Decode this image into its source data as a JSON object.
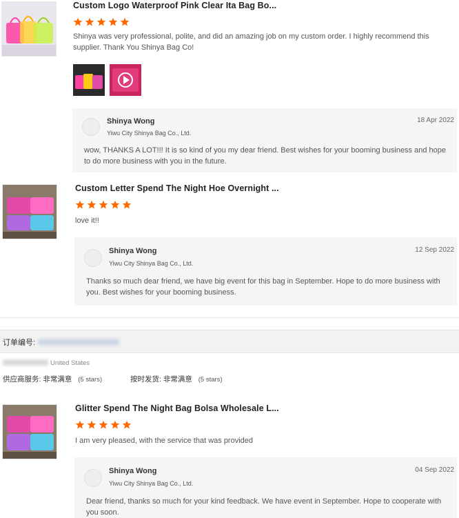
{
  "reviews": [
    {
      "product_title": "Custom Logo Waterproof Pink Clear Ita Bag Bo...",
      "rating": 5,
      "comment": "Shinya was very professional, polite, and did an amazing job on my custom order. I highly recommend this supplier. Thank You Shinya Bag Co!",
      "media_icons": [
        "photo-thumb",
        "video-play-icon"
      ],
      "reply": {
        "name": "Shinya Wong",
        "company": "Yiwu City Shinya Bag Co., Ltd.",
        "date": "18 Apr 2022",
        "text": "wow, THANKS A LOT!!! It is so kind of you my dear friend. Best wishes for your booming business and hope to do more business with you in the future."
      }
    },
    {
      "product_title": "Custom Letter Spend The Night Hoe Overnight ...",
      "rating": 5,
      "comment": "love it!!",
      "reply": {
        "name": "Shinya Wong",
        "company": "Yiwu City Shinya Bag Co., Ltd.",
        "date": "12 Sep 2022",
        "text": "Thanks so much dear friend, we have big event for this bag in September. Hope to do more business with you. Best wishes for your booming business."
      }
    },
    {
      "product_title": "Glitter Spend The Night Bag Bolsa Wholesale L...",
      "rating": 5,
      "comment": "I am very pleased, with the service that was provided",
      "reply": {
        "name": "Shinya Wong",
        "company": "Yiwu City Shinya Bag Co., Ltd.",
        "date": "04 Sep 2022",
        "text": "Dear friend, thanks so much for your kind feedback. We have event in September. Hope to cooperate with you soon."
      }
    }
  ],
  "order": {
    "label": "订单编号:",
    "country": "United States",
    "supplier_service_label": "供应商服务:",
    "supplier_service_value": "非常满意",
    "supplier_service_score": "(5 stars)",
    "on_time_label": "按时发货:",
    "on_time_value": "非常满意",
    "on_time_score": "(5 stars)"
  },
  "colors": {
    "star": "#ff6a00",
    "reply_bg": "#f4f5f7",
    "order_bar_bg": "#f2f2f2"
  }
}
